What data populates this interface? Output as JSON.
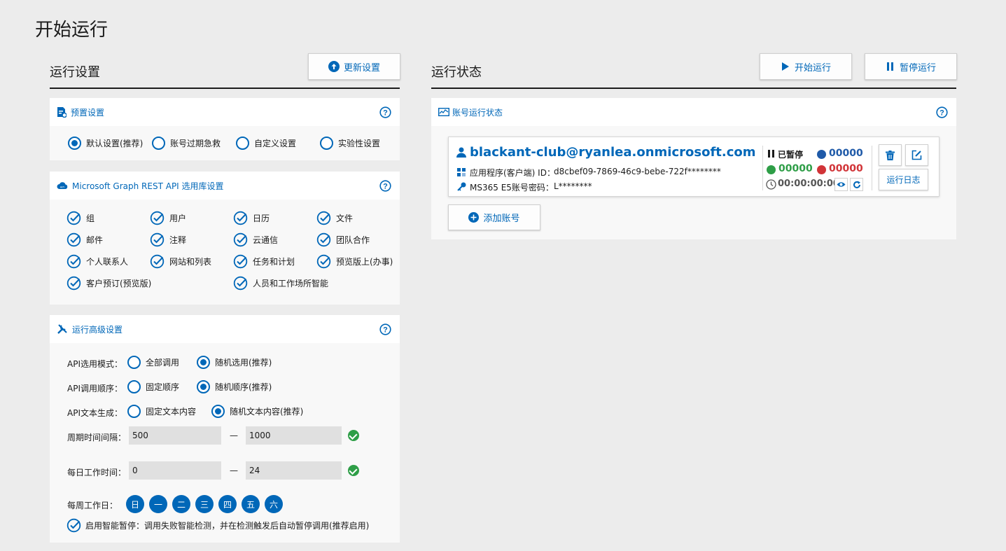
{
  "page_title": "开始运行",
  "left": {
    "title": "运行设置",
    "update_button": "更新设置",
    "preset": {
      "title": "预置设置",
      "options": [
        "默认设置(推荐)",
        "账号过期急救",
        "自定义设置",
        "实验性设置"
      ],
      "selected": "默认设置(推荐)"
    },
    "graph": {
      "title": "Microsoft Graph REST API 选用库设置",
      "items": [
        "组",
        "用户",
        "日历",
        "文件",
        "邮件",
        "注释",
        "云通信",
        "团队合作",
        "个人联系人",
        "网站和列表",
        "任务和计划",
        "预览版上(办事)",
        "客户预订(预览版)",
        "人员和工作场所智能"
      ]
    },
    "advanced": {
      "title": "运行高级设置",
      "api_mode_label": "API选用模式：",
      "api_mode_options": [
        "全部调用",
        "随机选用(推荐)"
      ],
      "api_order_label": "API调用顺序：",
      "api_order_options": [
        "固定顺序",
        "随机顺序(推荐)"
      ],
      "api_text_label": "API文本生成：",
      "api_text_options": [
        "固定文本内容",
        "随机文本内容(推荐)"
      ],
      "interval_label": "周期时间间隔：",
      "interval_min": "500",
      "interval_max": "1000",
      "work_hours_label": "每日工作时间：",
      "work_hours_min": "0",
      "work_hours_max": "24",
      "dash": "—",
      "weekdays_label": "每周工作日：",
      "weekdays": [
        "日",
        "一",
        "二",
        "三",
        "四",
        "五",
        "六"
      ],
      "smart_pause": "启用智能暂停：调用失败智能检测，并在检测触发后自动暂停调用(推荐启用)"
    }
  },
  "right": {
    "title": "运行状态",
    "start_button": "开始运行",
    "pause_button": "暂停运行",
    "status_card_title": "账号运行状态",
    "account": {
      "email": "blackant-club@ryanlea.onmicrosoft.com",
      "app_id_label": "应用程序(客户端) ID：",
      "app_id": "d8cbef09-7869-46c9-bebe-722f********",
      "password_label": "MS365 E5账号密码：",
      "password": "L********",
      "state": "已暂停",
      "count_total": "00000",
      "count_success": "00000",
      "count_fail": "00000",
      "elapsed": "00:00:00:00",
      "log_button": "运行日志"
    },
    "add_account_button": "添加账号"
  },
  "colors": {
    "accent": "#0067b8",
    "success": "#2e9e47",
    "fail": "#d13438",
    "total": "#1f5aa8"
  }
}
